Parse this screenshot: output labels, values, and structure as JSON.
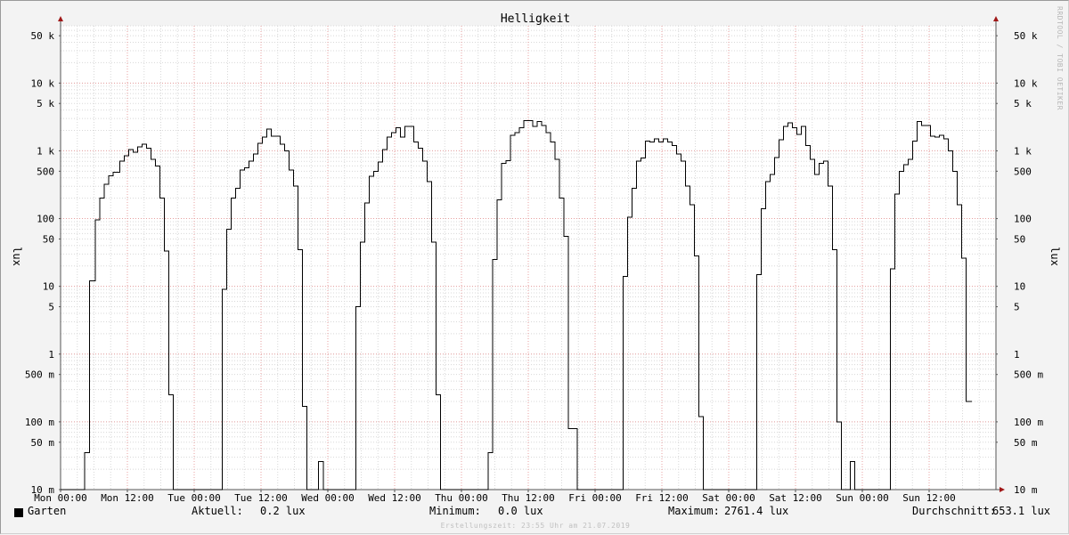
{
  "chart_data": {
    "type": "line",
    "title": "Helligkeit",
    "ylabel": "lux",
    "y_scale": "log",
    "ylim": [
      0.01,
      70000
    ],
    "y_ticks": [
      {
        "v": 50000,
        "label": "50 k"
      },
      {
        "v": 10000,
        "label": "10 k"
      },
      {
        "v": 5000,
        "label": "5 k"
      },
      {
        "v": 1000,
        "label": "1 k"
      },
      {
        "v": 500,
        "label": "500"
      },
      {
        "v": 100,
        "label": "100"
      },
      {
        "v": 50,
        "label": "50"
      },
      {
        "v": 10,
        "label": "10"
      },
      {
        "v": 5,
        "label": "5"
      },
      {
        "v": 1,
        "label": "1"
      },
      {
        "v": 0.5,
        "label": "500 m"
      },
      {
        "v": 0.1,
        "label": "100 m"
      },
      {
        "v": 0.05,
        "label": "50 m"
      },
      {
        "v": 0.01,
        "label": "10 m"
      }
    ],
    "x_unit": "hours",
    "xlim": [
      0,
      168
    ],
    "x_ticks": [
      {
        "h": 0,
        "label": "Mon 00:00"
      },
      {
        "h": 12,
        "label": "Mon 12:00"
      },
      {
        "h": 24,
        "label": "Tue 00:00"
      },
      {
        "h": 36,
        "label": "Tue 12:00"
      },
      {
        "h": 48,
        "label": "Wed 00:00"
      },
      {
        "h": 60,
        "label": "Wed 12:00"
      },
      {
        "h": 72,
        "label": "Thu 00:00"
      },
      {
        "h": 84,
        "label": "Thu 12:00"
      },
      {
        "h": 96,
        "label": "Fri 00:00"
      },
      {
        "h": 108,
        "label": "Fri 12:00"
      },
      {
        "h": 120,
        "label": "Sat 00:00"
      },
      {
        "h": 132,
        "label": "Sat 12:00"
      },
      {
        "h": 144,
        "label": "Sun 00:00"
      },
      {
        "h": 156,
        "label": "Sun 12:00"
      }
    ],
    "grid": true,
    "series": [
      {
        "name": "Garten",
        "color": "#000000",
        "points": [
          [
            0,
            0.01
          ],
          [
            4.3,
            0.01
          ],
          [
            4.3,
            0.035
          ],
          [
            5.2,
            0.035
          ],
          [
            5.2,
            12
          ],
          [
            6.2,
            12
          ],
          [
            6.2,
            95
          ],
          [
            7,
            95
          ],
          [
            7,
            200
          ],
          [
            7.8,
            200
          ],
          [
            7.8,
            320
          ],
          [
            8.6,
            320
          ],
          [
            8.6,
            430
          ],
          [
            9.4,
            430
          ],
          [
            9.4,
            480
          ],
          [
            10.6,
            480
          ],
          [
            10.6,
            700
          ],
          [
            11.4,
            700
          ],
          [
            11.4,
            850
          ],
          [
            12.2,
            850
          ],
          [
            12.2,
            1050
          ],
          [
            13,
            1050
          ],
          [
            13,
            950
          ],
          [
            13.8,
            950
          ],
          [
            13.8,
            1150
          ],
          [
            14.6,
            1150
          ],
          [
            14.6,
            1250
          ],
          [
            15.4,
            1250
          ],
          [
            15.4,
            1100
          ],
          [
            16.2,
            1100
          ],
          [
            16.2,
            750
          ],
          [
            17,
            750
          ],
          [
            17,
            600
          ],
          [
            17.8,
            600
          ],
          [
            17.8,
            200
          ],
          [
            18.6,
            200
          ],
          [
            18.6,
            33
          ],
          [
            19.4,
            33
          ],
          [
            19.4,
            0.25
          ],
          [
            20.2,
            0.25
          ],
          [
            20.2,
            0.01
          ],
          [
            29,
            0.01
          ],
          [
            29,
            9
          ],
          [
            29.8,
            9
          ],
          [
            29.8,
            70
          ],
          [
            30.6,
            70
          ],
          [
            30.6,
            200
          ],
          [
            31.4,
            200
          ],
          [
            31.4,
            280
          ],
          [
            32.2,
            280
          ],
          [
            32.2,
            520
          ],
          [
            33,
            520
          ],
          [
            33,
            560
          ],
          [
            33.8,
            560
          ],
          [
            33.8,
            700
          ],
          [
            34.6,
            700
          ],
          [
            34.6,
            900
          ],
          [
            35.4,
            900
          ],
          [
            35.4,
            1300
          ],
          [
            36.2,
            1300
          ],
          [
            36.2,
            1600
          ],
          [
            37,
            1600
          ],
          [
            37,
            2100
          ],
          [
            37.8,
            2100
          ],
          [
            37.8,
            1650
          ],
          [
            39.4,
            1650
          ],
          [
            39.4,
            1250
          ],
          [
            40.2,
            1250
          ],
          [
            40.2,
            1000
          ],
          [
            41,
            1000
          ],
          [
            41,
            520
          ],
          [
            41.8,
            520
          ],
          [
            41.8,
            300
          ],
          [
            42.6,
            300
          ],
          [
            42.6,
            35
          ],
          [
            43.4,
            35
          ],
          [
            43.4,
            0.17
          ],
          [
            44.2,
            0.17
          ],
          [
            44.2,
            0.01
          ],
          [
            46.3,
            0.01
          ],
          [
            46.3,
            0.026
          ],
          [
            47.2,
            0.026
          ],
          [
            47.2,
            0.01
          ],
          [
            53,
            0.01
          ],
          [
            53,
            5
          ],
          [
            53.8,
            5
          ],
          [
            53.8,
            45
          ],
          [
            54.6,
            45
          ],
          [
            54.6,
            170
          ],
          [
            55.4,
            170
          ],
          [
            55.4,
            420
          ],
          [
            56.2,
            420
          ],
          [
            56.2,
            500
          ],
          [
            57,
            500
          ],
          [
            57,
            680
          ],
          [
            57.8,
            680
          ],
          [
            57.8,
            1050
          ],
          [
            58.6,
            1050
          ],
          [
            58.6,
            1600
          ],
          [
            59.4,
            1600
          ],
          [
            59.4,
            1850
          ],
          [
            60.2,
            1850
          ],
          [
            60.2,
            2200
          ],
          [
            61,
            2200
          ],
          [
            61,
            1600
          ],
          [
            61.8,
            1600
          ],
          [
            61.8,
            2300
          ],
          [
            63.4,
            2300
          ],
          [
            63.4,
            1350
          ],
          [
            64.2,
            1350
          ],
          [
            64.2,
            1100
          ],
          [
            65,
            1100
          ],
          [
            65,
            700
          ],
          [
            65.8,
            700
          ],
          [
            65.8,
            350
          ],
          [
            66.6,
            350
          ],
          [
            66.6,
            45
          ],
          [
            67.4,
            45
          ],
          [
            67.4,
            0.25
          ],
          [
            68.2,
            0.25
          ],
          [
            68.2,
            0.01
          ],
          [
            76.8,
            0.01
          ],
          [
            76.8,
            0.035
          ],
          [
            77.6,
            0.035
          ],
          [
            77.6,
            25
          ],
          [
            78.4,
            25
          ],
          [
            78.4,
            190
          ],
          [
            79.2,
            190
          ],
          [
            79.2,
            650
          ],
          [
            80,
            650
          ],
          [
            80,
            720
          ],
          [
            80.8,
            720
          ],
          [
            80.8,
            1700
          ],
          [
            81.6,
            1700
          ],
          [
            81.6,
            1850
          ],
          [
            82.4,
            1850
          ],
          [
            82.4,
            2200
          ],
          [
            83.2,
            2200
          ],
          [
            83.2,
            2800
          ],
          [
            84.8,
            2800
          ],
          [
            84.8,
            2300
          ],
          [
            85.6,
            2300
          ],
          [
            85.6,
            2700
          ],
          [
            86.4,
            2700
          ],
          [
            86.4,
            2350
          ],
          [
            87.2,
            2350
          ],
          [
            87.2,
            1850
          ],
          [
            88,
            1850
          ],
          [
            88,
            1350
          ],
          [
            88.8,
            1350
          ],
          [
            88.8,
            750
          ],
          [
            89.6,
            750
          ],
          [
            89.6,
            200
          ],
          [
            90.4,
            200
          ],
          [
            90.4,
            55
          ],
          [
            91.2,
            55
          ],
          [
            91.2,
            0.08
          ],
          [
            92.8,
            0.08
          ],
          [
            92.8,
            0.01
          ],
          [
            101,
            0.01
          ],
          [
            101,
            14
          ],
          [
            101.8,
            14
          ],
          [
            101.8,
            105
          ],
          [
            102.6,
            105
          ],
          [
            102.6,
            280
          ],
          [
            103.4,
            280
          ],
          [
            103.4,
            700
          ],
          [
            104.2,
            700
          ],
          [
            104.2,
            780
          ],
          [
            105,
            780
          ],
          [
            105,
            1400
          ],
          [
            105.8,
            1400
          ],
          [
            105.8,
            1350
          ],
          [
            106.6,
            1350
          ],
          [
            106.6,
            1500
          ],
          [
            107.4,
            1500
          ],
          [
            107.4,
            1350
          ],
          [
            108.2,
            1350
          ],
          [
            108.2,
            1500
          ],
          [
            109,
            1500
          ],
          [
            109,
            1350
          ],
          [
            109.8,
            1350
          ],
          [
            109.8,
            1200
          ],
          [
            110.6,
            1200
          ],
          [
            110.6,
            900
          ],
          [
            111.4,
            900
          ],
          [
            111.4,
            700
          ],
          [
            112.2,
            700
          ],
          [
            112.2,
            300
          ],
          [
            113,
            300
          ],
          [
            113,
            160
          ],
          [
            113.8,
            160
          ],
          [
            113.8,
            28
          ],
          [
            114.6,
            28
          ],
          [
            114.6,
            0.12
          ],
          [
            115.4,
            0.12
          ],
          [
            115.4,
            0.01
          ],
          [
            125,
            0.01
          ],
          [
            125,
            15
          ],
          [
            125.8,
            15
          ],
          [
            125.8,
            140
          ],
          [
            126.6,
            140
          ],
          [
            126.6,
            350
          ],
          [
            127.4,
            350
          ],
          [
            127.4,
            450
          ],
          [
            128.2,
            450
          ],
          [
            128.2,
            800
          ],
          [
            129,
            800
          ],
          [
            129,
            1450
          ],
          [
            129.8,
            1450
          ],
          [
            129.8,
            2300
          ],
          [
            130.6,
            2300
          ],
          [
            130.6,
            2600
          ],
          [
            131.4,
            2600
          ],
          [
            131.4,
            2200
          ],
          [
            132.2,
            2200
          ],
          [
            132.2,
            1750
          ],
          [
            133,
            1750
          ],
          [
            133,
            2300
          ],
          [
            133.8,
            2300
          ],
          [
            133.8,
            1200
          ],
          [
            134.6,
            1200
          ],
          [
            134.6,
            750
          ],
          [
            135.4,
            750
          ],
          [
            135.4,
            450
          ],
          [
            136.2,
            450
          ],
          [
            136.2,
            650
          ],
          [
            137,
            650
          ],
          [
            137,
            700
          ],
          [
            137.8,
            700
          ],
          [
            137.8,
            300
          ],
          [
            138.6,
            300
          ],
          [
            138.6,
            35
          ],
          [
            139.4,
            35
          ],
          [
            139.4,
            0.1
          ],
          [
            140.2,
            0.1
          ],
          [
            140.2,
            0.01
          ],
          [
            141.8,
            0.01
          ],
          [
            141.8,
            0.026
          ],
          [
            142.6,
            0.026
          ],
          [
            142.6,
            0.01
          ],
          [
            149,
            0.01
          ],
          [
            149,
            18
          ],
          [
            149.8,
            18
          ],
          [
            149.8,
            230
          ],
          [
            150.6,
            230
          ],
          [
            150.6,
            500
          ],
          [
            151.4,
            500
          ],
          [
            151.4,
            620
          ],
          [
            152.2,
            620
          ],
          [
            152.2,
            750
          ],
          [
            153,
            750
          ],
          [
            153,
            1400
          ],
          [
            153.8,
            1400
          ],
          [
            153.8,
            2700
          ],
          [
            154.6,
            2700
          ],
          [
            154.6,
            2350
          ],
          [
            156.2,
            2350
          ],
          [
            156.2,
            1650
          ],
          [
            157,
            1650
          ],
          [
            157,
            1600
          ],
          [
            157.8,
            1600
          ],
          [
            157.8,
            1700
          ],
          [
            158.6,
            1700
          ],
          [
            158.6,
            1500
          ],
          [
            159.4,
            1500
          ],
          [
            159.4,
            1000
          ],
          [
            160.2,
            1000
          ],
          [
            160.2,
            500
          ],
          [
            161,
            500
          ],
          [
            161,
            160
          ],
          [
            161.8,
            160
          ],
          [
            161.8,
            26
          ],
          [
            162.6,
            26
          ],
          [
            162.6,
            0.2
          ],
          [
            163.7,
            0.2
          ]
        ]
      }
    ]
  },
  "legend": {
    "series_label": "Garten",
    "aktuell_label": "Aktuell:",
    "aktuell_value": "0.2 lux",
    "minimum_label": "Minimum:",
    "minimum_value": "0.0 lux",
    "maximum_label": "Maximum:",
    "maximum_value": "2761.4 lux",
    "durchschnitt_label": "Durchschnitt:",
    "durchschnitt_value": "653.1 lux"
  },
  "footer": "Erstellungszeit: 23:55 Uhr am 21.07.2019",
  "watermark": "RRDTOOL / TOBI OETIKER",
  "colors": {
    "background": "#f3f3f3",
    "canvas": "#ffffff",
    "grid_major": "#e8a0a0",
    "grid_minor": "#d8d8d8",
    "axis_arrow": "#a01818",
    "line": "#000000"
  }
}
